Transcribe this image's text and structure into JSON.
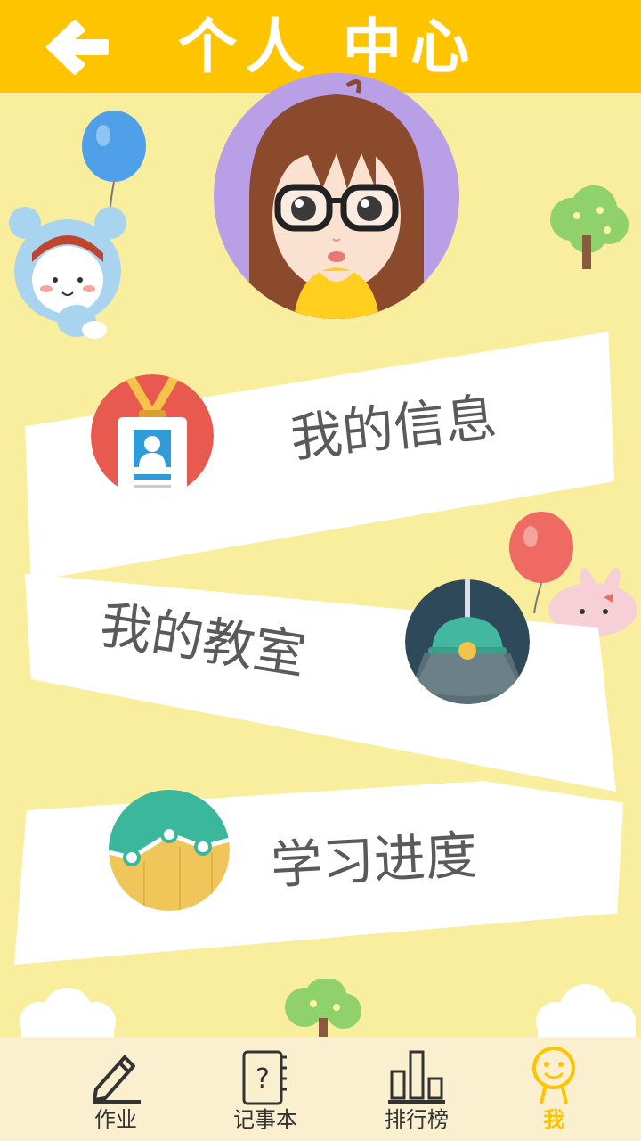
{
  "header": {
    "title": "个人 中心",
    "back_icon": "back-arrow-icon"
  },
  "menu": [
    {
      "label": "我的信息",
      "icon": "id-badge-icon"
    },
    {
      "label": "我的教室",
      "icon": "lamp-icon"
    },
    {
      "label": "学习进度",
      "icon": "progress-chart-icon"
    }
  ],
  "bottom_nav": [
    {
      "label": "作业",
      "icon": "pencil-icon",
      "active": false
    },
    {
      "label": "记事本",
      "icon": "notebook-icon",
      "active": false
    },
    {
      "label": "排行榜",
      "icon": "bar-chart-icon",
      "active": false
    },
    {
      "label": "我",
      "icon": "smiley-person-icon",
      "active": true
    }
  ],
  "colors": {
    "header": "#ffc400",
    "background": "#f9ee9e",
    "active_tab": "#ffc400",
    "label_text": "#5a5a5a"
  }
}
